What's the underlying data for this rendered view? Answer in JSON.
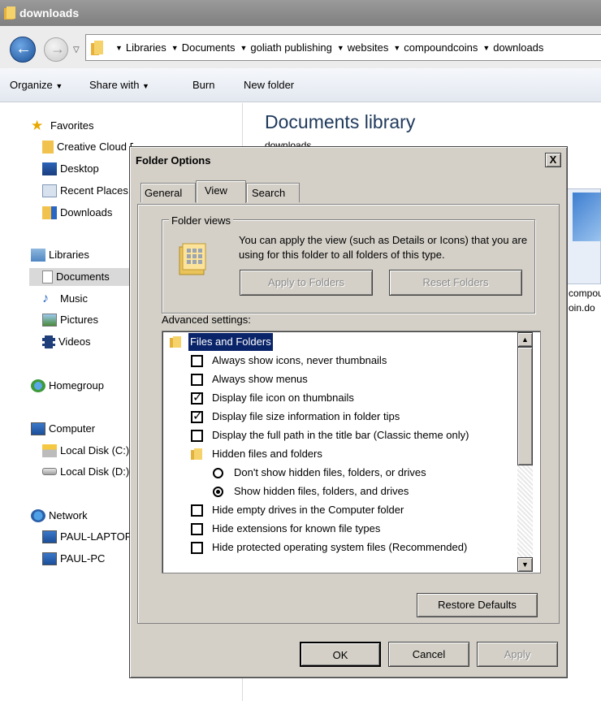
{
  "window": {
    "title": "downloads"
  },
  "address": {
    "crumbs": [
      "Libraries",
      "Documents",
      "goliath publishing",
      "websites",
      "compoundcoins",
      "downloads"
    ]
  },
  "toolbar": {
    "organize": "Organize",
    "share_with": "Share with",
    "burn": "Burn",
    "new_folder": "New folder"
  },
  "sidebar": {
    "favorites": "Favorites",
    "creative_cloud": "Creative Cloud Files",
    "desktop": "Desktop",
    "recent_places": "Recent Places",
    "downloads": "Downloads",
    "libraries": "Libraries",
    "documents": "Documents",
    "music": "Music",
    "pictures": "Pictures",
    "videos": "Videos",
    "homegroup": "Homegroup",
    "computer": "Computer",
    "local_disk_c": "Local Disk (C:)",
    "local_disk_d": "Local Disk (D:)",
    "network": "Network",
    "paul_laptop": "PAUL-LAPTOP",
    "paul_pc": "PAUL-PC"
  },
  "library": {
    "title": "Documents library",
    "subtitle": "downloads",
    "file_line1": "compou",
    "file_line2": "oin.do"
  },
  "dialog": {
    "title": "Folder Options",
    "close": "X",
    "tabs": {
      "general": "General",
      "view": "View",
      "search": "Search"
    },
    "folder_views": {
      "legend": "Folder views",
      "description": "You can apply the view (such as Details or Icons) that you are using for this folder to all folders of this type.",
      "apply_button": "Apply to Folders",
      "reset_button": "Reset Folders"
    },
    "advanced_label": "Advanced settings:",
    "settings": {
      "files_and_folders": "Files and Folders",
      "always_show_icons": "Always show icons, never thumbnails",
      "always_show_menus": "Always show menus",
      "display_file_icon": "Display file icon on thumbnails",
      "display_file_size": "Display file size information in folder tips",
      "display_full_path": "Display the full path in the title bar (Classic theme only)",
      "hidden_files": "Hidden files and folders",
      "dont_show_hidden": "Don't show hidden files, folders, or drives",
      "show_hidden": "Show hidden files, folders, and drives",
      "hide_empty_drives": "Hide empty drives in the Computer folder",
      "hide_extensions": "Hide extensions for known file types",
      "hide_protected": "Hide protected operating system files (Recommended)"
    },
    "restore_defaults": "Restore Defaults",
    "ok": "OK",
    "cancel": "Cancel",
    "apply": "Apply"
  },
  "colors": {
    "dialog_face": "#d4d0c8",
    "selection": "#0a246a",
    "library_title": "#1e395b"
  }
}
